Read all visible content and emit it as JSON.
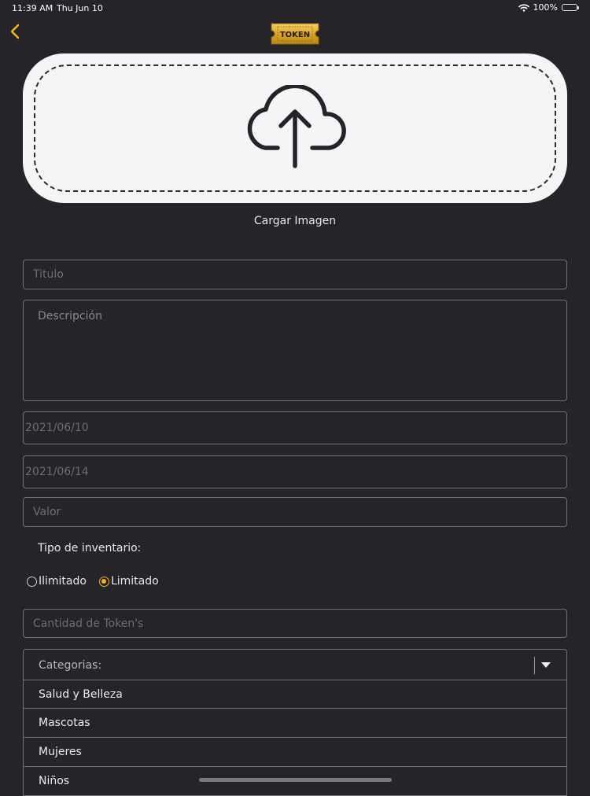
{
  "status": {
    "time": "11:39 AM",
    "date": "Thu Jun 10",
    "battery": "100%",
    "battery_level": 1.0
  },
  "header": {
    "logo_text": "TOKEN",
    "logo_color": "#d9a628"
  },
  "upload": {
    "label": "Cargar Imagen"
  },
  "form": {
    "title_placeholder": "Titulo",
    "description_placeholder": "Descripción",
    "start_date": "2021/06/10",
    "end_date": "2021/06/14",
    "value_placeholder": "Valor",
    "inventory_label": "Tipo de inventario:",
    "inventory_options": [
      {
        "label": "Ilimitado",
        "selected": false
      },
      {
        "label": "Limitado",
        "selected": true
      }
    ],
    "quantity_placeholder": "Cantidad de Token's",
    "categories_label": "Categorias:",
    "categories": [
      "Salud y Belleza",
      "Mascotas",
      "Mujeres",
      "Niños"
    ]
  },
  "colors": {
    "background": "#252428",
    "accent": "#f2b320",
    "border": "#727276"
  }
}
